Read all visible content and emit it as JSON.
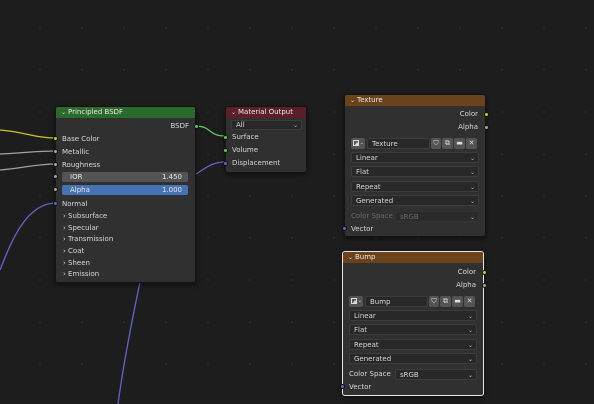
{
  "colors": {
    "background": "#1d1d1d",
    "node_body": "#303030",
    "shader_header": "#2c6a2c",
    "output_header": "#5c1e2a",
    "texture_header": "#6a421b",
    "socket_color": "#c7c729",
    "socket_float": "#a1a1a1",
    "socket_vector": "#6363c7",
    "socket_shader": "#63c763",
    "field_selected": "#4772b3"
  },
  "principled": {
    "title": "Principled BSDF",
    "output_label": "BSDF",
    "inputs": [
      {
        "label": "Base Color",
        "socket": "color"
      },
      {
        "label": "Metallic",
        "socket": "float"
      },
      {
        "label": "Roughness",
        "socket": "float"
      }
    ],
    "ior": {
      "label": "IOR",
      "value": "1.450"
    },
    "alpha": {
      "label": "Alpha",
      "value": "1.000"
    },
    "normal_label": "Normal",
    "panels": [
      "Subsurface",
      "Specular",
      "Transmission",
      "Coat",
      "Sheen",
      "Emission"
    ]
  },
  "material_output": {
    "title": "Material Output",
    "target": "All",
    "inputs": [
      "Surface",
      "Volume",
      "Displacement"
    ]
  },
  "texture": {
    "title": "Texture",
    "outputs": [
      "Color",
      "Alpha"
    ],
    "image_name": "Texture",
    "interpolation": "Linear",
    "projection": "Flat",
    "extension": "Repeat",
    "source": "Generated",
    "color_space_label": "Color Space",
    "color_space": "sRGB",
    "vector_label": "Vector"
  },
  "bump": {
    "title": "Bump",
    "outputs": [
      "Color",
      "Alpha"
    ],
    "image_name": "Bump",
    "interpolation": "Linear",
    "projection": "Flat",
    "extension": "Repeat",
    "source": "Generated",
    "color_space_label": "Color Space",
    "color_space": "sRGB",
    "vector_label": "Vector"
  },
  "icons": {
    "collapse": "chevron-down-icon",
    "panel": "chevron-right-icon",
    "image": "image-icon",
    "fake_user": "shield-icon",
    "new": "duplicate-icon",
    "open": "folder-icon",
    "unlink": "close-icon"
  }
}
